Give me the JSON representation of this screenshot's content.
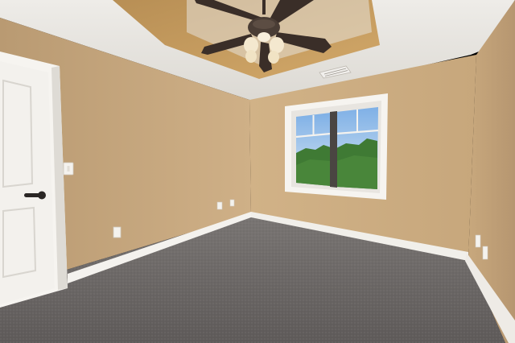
{
  "scene": {
    "kind": "empty-bedroom-interior",
    "colors": {
      "wall_left": "#c9a87e",
      "wall_back": "#cfae83",
      "wall_right": "#c4a47a",
      "ceiling": "#e9e7e2",
      "tray_ceiling": "#c99e5e",
      "carpet": "#6e6a68",
      "trim": "#f4f2ee",
      "door": "#f3f1ed",
      "sky": "#9ec4ea",
      "trees": "#3f7a34",
      "fan_blade": "#3a2e28"
    },
    "objects": {
      "ceiling_fan": "ceiling-fan-with-light",
      "door": "paneled-door-with-lever-handle",
      "window": "double-casement-window",
      "vent": "ceiling-air-vent",
      "outlets": "wall-outlets",
      "switch": "light-switch"
    }
  }
}
